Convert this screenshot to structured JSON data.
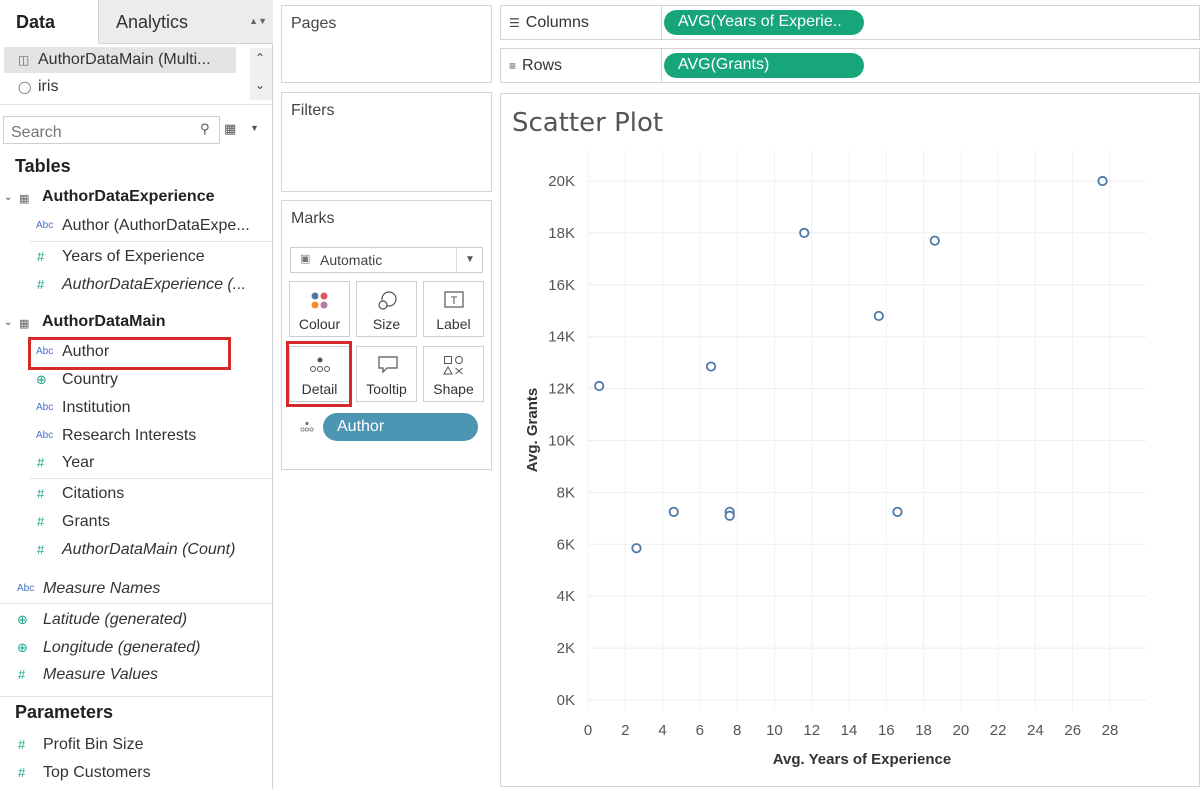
{
  "data_pane": {
    "tabs": {
      "data": "Data",
      "analytics": "Analytics"
    },
    "data_sources": [
      {
        "label": "AuthorDataMain (Multi...",
        "icon": "datasource-multi-icon",
        "selected": true
      },
      {
        "label": "iris",
        "icon": "database-icon",
        "selected": false
      }
    ],
    "search_placeholder": "Search",
    "tables_title": "Tables",
    "tables": [
      {
        "name": "AuthorDataExperience",
        "fields": [
          {
            "label": "Author (AuthorDataExpe...",
            "type": "Abc",
            "italic": false
          },
          {
            "label": "Years of Experience",
            "type": "#",
            "italic": false
          },
          {
            "label": "AuthorDataExperience (...",
            "type": "#",
            "italic": true
          }
        ]
      },
      {
        "name": "AuthorDataMain",
        "fields": [
          {
            "label": "Author",
            "type": "Abc",
            "italic": false
          },
          {
            "label": "Country",
            "type": "globe",
            "italic": false
          },
          {
            "label": "Institution",
            "type": "Abc",
            "italic": false
          },
          {
            "label": "Research Interests",
            "type": "Abc",
            "italic": false
          },
          {
            "label": "Year",
            "type": "#",
            "italic": false
          },
          {
            "label": "Citations",
            "type": "#",
            "italic": false
          },
          {
            "label": "Grants",
            "type": "#",
            "italic": false
          },
          {
            "label": "AuthorDataMain (Count)",
            "type": "#",
            "italic": true
          }
        ]
      }
    ],
    "extra_fields": [
      {
        "label": "Measure Names",
        "type": "Abc",
        "italic": true
      },
      {
        "label": "Latitude (generated)",
        "type": "globe",
        "italic": true
      },
      {
        "label": "Longitude (generated)",
        "type": "globe",
        "italic": true
      },
      {
        "label": "Measure Values",
        "type": "#",
        "italic": true
      }
    ],
    "parameters_title": "Parameters",
    "parameters": [
      {
        "label": "Profit Bin Size",
        "type": "#"
      },
      {
        "label": "Top Customers",
        "type": "#"
      }
    ]
  },
  "cards": {
    "pages": "Pages",
    "filters": "Filters",
    "marks": "Marks",
    "mark_type": "Automatic",
    "mark_buttons": [
      {
        "label": "Colour",
        "icon": "colour-icon"
      },
      {
        "label": "Size",
        "icon": "size-icon"
      },
      {
        "label": "Label",
        "icon": "label-icon"
      },
      {
        "label": "Detail",
        "icon": "detail-icon"
      },
      {
        "label": "Tooltip",
        "icon": "tooltip-icon"
      },
      {
        "label": "Shape",
        "icon": "shape-icon"
      }
    ],
    "detail_pill": "Author"
  },
  "shelves": {
    "columns": {
      "label": "Columns",
      "pill": "AVG(Years of Experie.."
    },
    "rows": {
      "label": "Rows",
      "pill": "AVG(Grants)"
    }
  },
  "chart_data": {
    "type": "scatter",
    "title": "Scatter Plot",
    "xlabel": "Avg. Years of Experience",
    "ylabel": "Avg. Grants",
    "x_ticks": [
      "0",
      "2",
      "4",
      "6",
      "8",
      "10",
      "12",
      "14",
      "16",
      "18",
      "20",
      "22",
      "24",
      "26",
      "28"
    ],
    "y_ticks": [
      "0K",
      "2K",
      "4K",
      "6K",
      "8K",
      "10K",
      "12K",
      "14K",
      "16K",
      "18K",
      "20K"
    ],
    "xlim": [
      0,
      28
    ],
    "ylim": [
      0,
      20000
    ],
    "grid": true,
    "marker_color": "#4e79a7",
    "points": [
      {
        "x": 0.6,
        "y": 12100
      },
      {
        "x": 2.6,
        "y": 5850
      },
      {
        "x": 4.6,
        "y": 7250
      },
      {
        "x": 6.6,
        "y": 12850
      },
      {
        "x": 7.6,
        "y": 7250
      },
      {
        "x": 7.6,
        "y": 7100
      },
      {
        "x": 11.6,
        "y": 18000
      },
      {
        "x": 15.6,
        "y": 14800
      },
      {
        "x": 16.6,
        "y": 7250
      },
      {
        "x": 18.6,
        "y": 17700
      },
      {
        "x": 27.6,
        "y": 20000
      }
    ]
  }
}
